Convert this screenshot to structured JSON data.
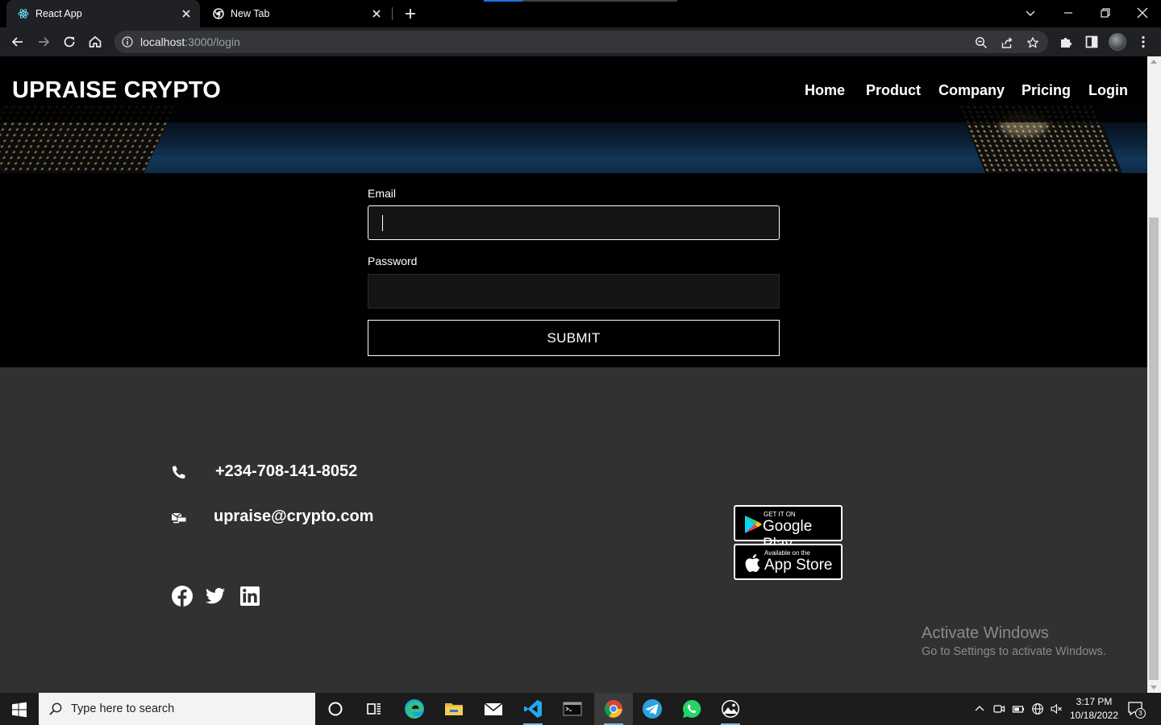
{
  "browser": {
    "tabs": [
      {
        "label": "React App",
        "active": true
      },
      {
        "label": "New Tab",
        "active": false
      }
    ],
    "url_host": "localhost",
    "url_path": ":3000/login"
  },
  "page": {
    "brand": "UPRAISE CRYPTO",
    "nav": [
      "Home",
      "Product",
      "Company",
      "Pricing",
      "Login"
    ],
    "form": {
      "email_label": "Email",
      "email_value": "",
      "password_label": "Password",
      "password_value": "",
      "submit_label": "SUBMIT"
    },
    "footer": {
      "phone": "+234-708-141-8052",
      "email": "upraise@crypto.com",
      "google_play": {
        "small": "GET IT ON",
        "big": "Google Play"
      },
      "app_store": {
        "small": "Available on the",
        "big": "App Store"
      },
      "social_icons": [
        "facebook-icon",
        "twitter-icon",
        "linkedin-icon"
      ]
    }
  },
  "watermark": {
    "title": "Activate Windows",
    "subtitle": "Go to Settings to activate Windows."
  },
  "taskbar": {
    "search_placeholder": "Type here to search",
    "time": "3:17 PM",
    "date": "10/18/2022",
    "notification_count": "3",
    "apps": [
      "cortana-icon",
      "task-view-icon",
      "edge-icon",
      "file-explorer-icon",
      "mail-icon",
      "vscode-icon",
      "terminal-icon",
      "chrome-icon",
      "telegram-icon",
      "whatsapp-icon",
      "photos-icon"
    ]
  },
  "colors": {
    "page_background": "#000000",
    "footer_background": "#313131",
    "browser_chrome": "#202124",
    "taskbar": "#1c1c1c"
  }
}
